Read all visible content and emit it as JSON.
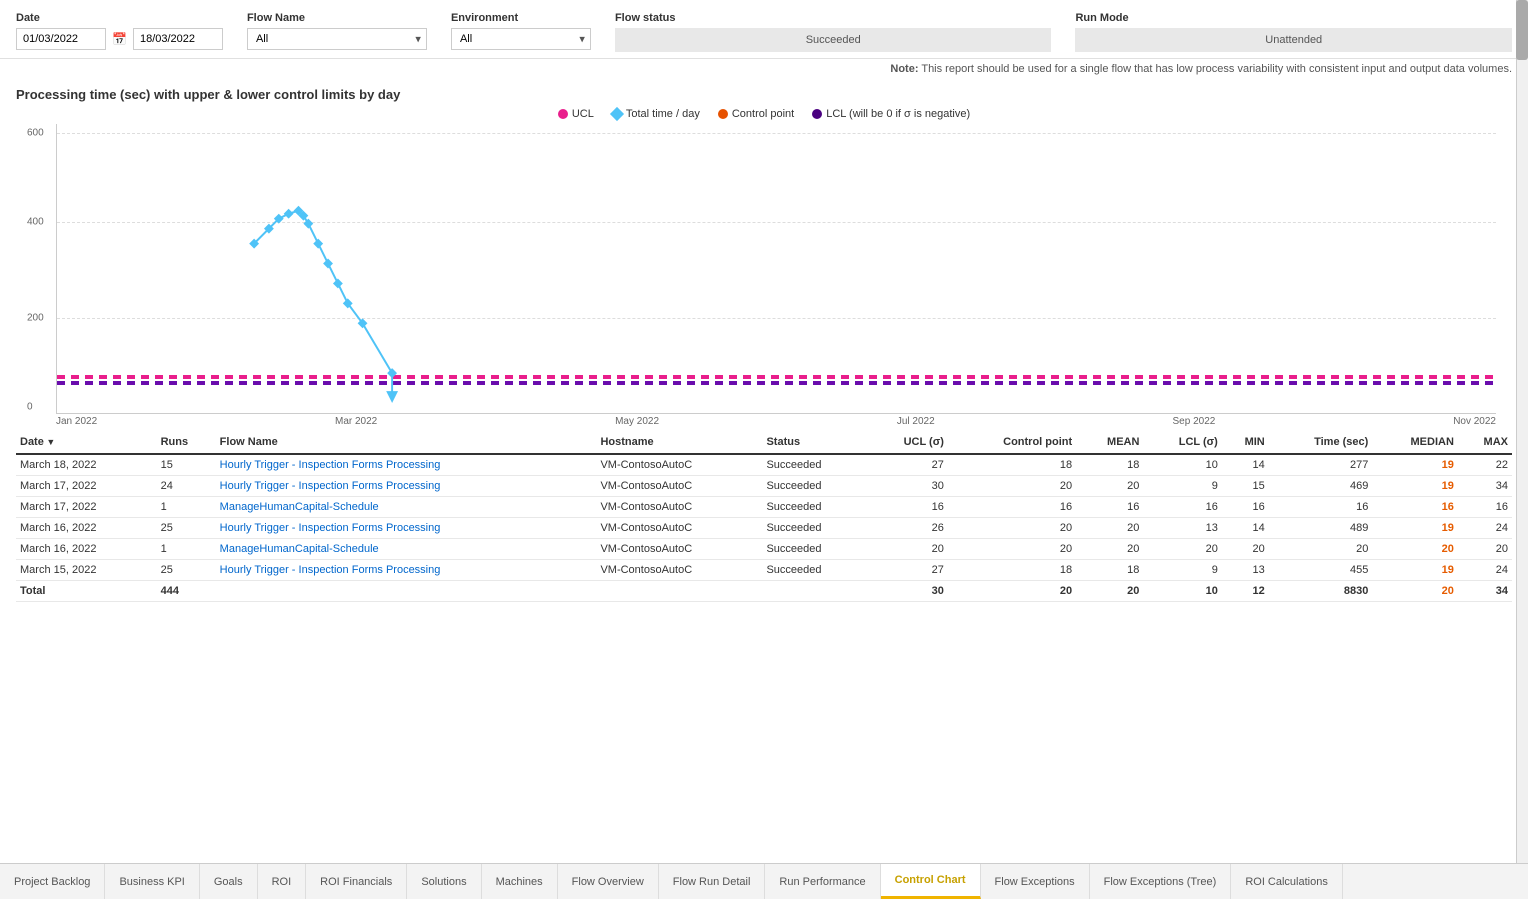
{
  "filters": {
    "date_label": "Date",
    "date_from": "01/03/2022",
    "date_to": "18/03/2022",
    "flow_name_label": "Flow Name",
    "flow_name_value": "All",
    "environment_label": "Environment",
    "environment_value": "All",
    "flow_status_label": "Flow status",
    "flow_status_value": "Succeeded",
    "run_mode_label": "Run Mode",
    "run_mode_value": "Unattended"
  },
  "note": "Note:",
  "note_text": "This report should be used for a single flow that has low process variability with consistent input and output data volumes.",
  "chart": {
    "title": "Processing time (sec) with upper & lower control limits by day",
    "legend": [
      {
        "label": "UCL",
        "color": "#e91e8c",
        "type": "dot"
      },
      {
        "label": "Total time / day",
        "color": "#4fc3f7",
        "type": "diamond"
      },
      {
        "label": "Control point",
        "color": "#e65100",
        "type": "dot"
      },
      {
        "label": "LCL (will be 0 if σ is negative)",
        "color": "#4a0080",
        "type": "dot"
      }
    ],
    "y_labels": [
      "0",
      "200",
      "400",
      "600"
    ],
    "x_labels": [
      "Jan 2022",
      "Mar 2022",
      "May 2022",
      "Jul 2022",
      "Sep 2022",
      "Nov 2022"
    ]
  },
  "table": {
    "columns": [
      "Date",
      "Runs",
      "Flow Name",
      "Hostname",
      "Status",
      "UCL (σ)",
      "Control point",
      "MEAN",
      "LCL (σ)",
      "MIN",
      "Time (sec)",
      "MEDIAN",
      "MAX"
    ],
    "rows": [
      {
        "date": "March 18, 2022",
        "runs": "15",
        "flow_name": "Hourly Trigger - Inspection Forms Processing",
        "hostname": "VM-ContosoAutoC",
        "status": "Succeeded",
        "ucl": "27",
        "control_point": "18",
        "mean": "18",
        "lcl": "10",
        "min": "14",
        "time_sec": "277",
        "median": "19",
        "max": "22"
      },
      {
        "date": "March 17, 2022",
        "runs": "24",
        "flow_name": "Hourly Trigger - Inspection Forms Processing",
        "hostname": "VM-ContosoAutoC",
        "status": "Succeeded",
        "ucl": "30",
        "control_point": "20",
        "mean": "20",
        "lcl": "9",
        "min": "15",
        "time_sec": "469",
        "median": "19",
        "max": "34"
      },
      {
        "date": "March 17, 2022",
        "runs": "1",
        "flow_name": "ManageHumanCapital-Schedule",
        "hostname": "VM-ContosoAutoC",
        "status": "Succeeded",
        "ucl": "16",
        "control_point": "16",
        "mean": "16",
        "lcl": "16",
        "min": "16",
        "time_sec": "16",
        "median": "16",
        "max": "16"
      },
      {
        "date": "March 16, 2022",
        "runs": "25",
        "flow_name": "Hourly Trigger - Inspection Forms Processing",
        "hostname": "VM-ContosoAutoC",
        "status": "Succeeded",
        "ucl": "26",
        "control_point": "20",
        "mean": "20",
        "lcl": "13",
        "min": "14",
        "time_sec": "489",
        "median": "19",
        "max": "24"
      },
      {
        "date": "March 16, 2022",
        "runs": "1",
        "flow_name": "ManageHumanCapital-Schedule",
        "hostname": "VM-ContosoAutoC",
        "status": "Succeeded",
        "ucl": "20",
        "control_point": "20",
        "mean": "20",
        "lcl": "20",
        "min": "20",
        "time_sec": "20",
        "median": "20",
        "max": "20"
      },
      {
        "date": "March 15, 2022",
        "runs": "25",
        "flow_name": "Hourly Trigger - Inspection Forms Processing",
        "hostname": "VM-ContosoAutoC",
        "status": "Succeeded",
        "ucl": "27",
        "control_point": "18",
        "mean": "18",
        "lcl": "9",
        "min": "13",
        "time_sec": "455",
        "median": "19",
        "max": "24"
      }
    ],
    "total": {
      "label": "Total",
      "runs": "444",
      "ucl": "30",
      "control_point": "20",
      "mean": "20",
      "lcl": "10",
      "min": "12",
      "time_sec": "8830",
      "median": "20",
      "max": "34"
    }
  },
  "tabs": [
    {
      "label": "Project Backlog",
      "active": false
    },
    {
      "label": "Business KPI",
      "active": false
    },
    {
      "label": "Goals",
      "active": false
    },
    {
      "label": "ROI",
      "active": false
    },
    {
      "label": "ROI Financials",
      "active": false
    },
    {
      "label": "Solutions",
      "active": false
    },
    {
      "label": "Machines",
      "active": false
    },
    {
      "label": "Flow Overview",
      "active": false
    },
    {
      "label": "Flow Run Detail",
      "active": false
    },
    {
      "label": "Run Performance",
      "active": false
    },
    {
      "label": "Control Chart",
      "active": true
    },
    {
      "label": "Flow Exceptions",
      "active": false
    },
    {
      "label": "Flow Exceptions (Tree)",
      "active": false
    },
    {
      "label": "ROI Calculations",
      "active": false
    }
  ]
}
